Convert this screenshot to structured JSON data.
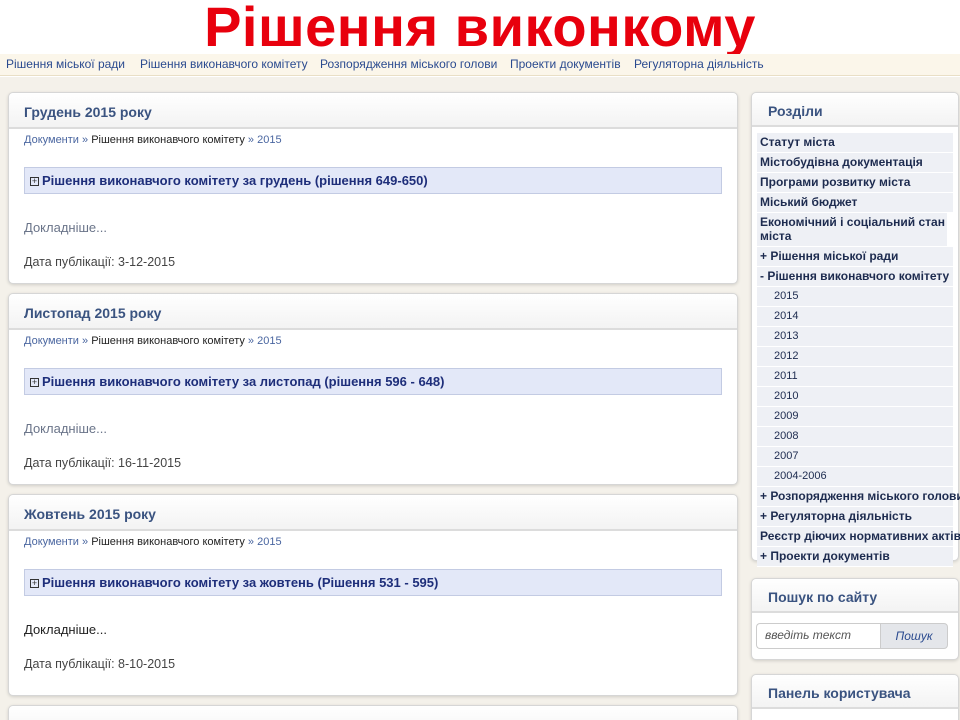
{
  "slide_title": "Рішення виконкому",
  "topnav": [
    "Рішення міської ради",
    "Рішення виконавчого комітету",
    "Розпорядження міського голови",
    "Проекти документів",
    "Регуляторна діяльність"
  ],
  "posts": [
    {
      "title": "Грудень 2015 року",
      "crumb_root": "Документи",
      "crumb_sep": "»",
      "crumb_mid": "Рішення виконавчого комітету",
      "crumb_leaf": "2015",
      "doc_plus": "+",
      "doc_title": "Рішення виконавчого комітету за грудень (рішення 649-650)",
      "more": "Докладніше...",
      "date": "Дата публікації: 3-12-2015"
    },
    {
      "title": "Листопад 2015 року",
      "crumb_root": "Документи",
      "crumb_sep": "»",
      "crumb_mid": "Рішення виконавчого комітету",
      "crumb_leaf": "2015",
      "doc_plus": "+",
      "doc_title": "Рішення виконавчого комітету за листопад (рішення 596 - 648)",
      "more": "Докладніше...",
      "date": "Дата публікації: 16-11-2015"
    },
    {
      "title": "Жовтень 2015 року",
      "crumb_root": "Документи",
      "crumb_sep": "»",
      "crumb_mid": "Рішення виконавчого комітету",
      "crumb_leaf": "2015",
      "doc_plus": "+",
      "doc_title": "Рішення виконавчого комітету за жовтень (Рішення 531 - 595)",
      "more": "Докладніше...",
      "date": "Дата публікації: 8-10-2015"
    }
  ],
  "sidebar": {
    "sections_title": "Розділи",
    "menu": [
      "Статут міста",
      "Містобудівна документація",
      "Програми розвитку міста",
      "Міський бюджет",
      "Економічний і соціальний стан міста",
      "+ Рішення міської ради",
      "- Рішення виконавчого комітету",
      "2015",
      "2014",
      "2013",
      "2012",
      "2011",
      "2010",
      "2009",
      "2008",
      "2007",
      "2004-2006",
      "+ Розпорядження міського голови",
      "+ Регуляторна діяльність",
      "Реєстр діючих нормативних актів",
      "+ Проекти документів"
    ],
    "search_title": "Пошук по сайту",
    "search_placeholder": "введіть текст",
    "search_button": "Пошук",
    "user_panel_title": "Панель користувача"
  }
}
